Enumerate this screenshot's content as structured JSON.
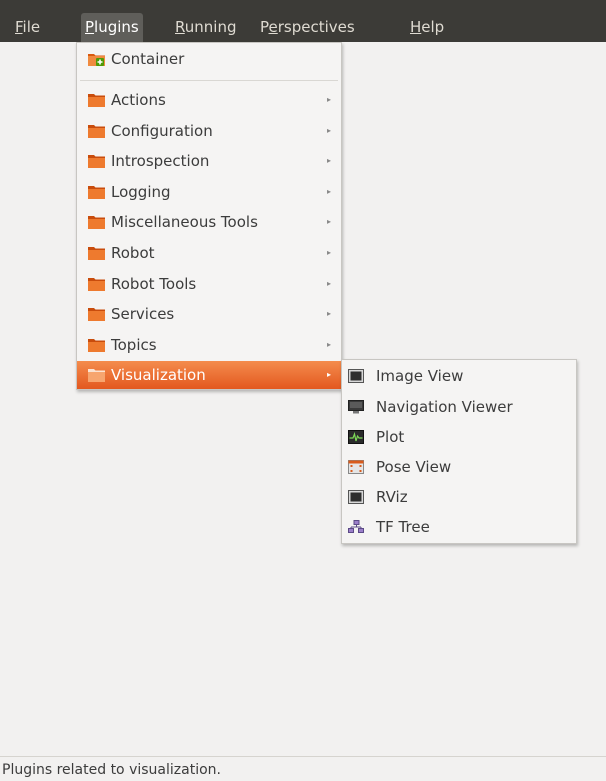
{
  "menubar": {
    "items": [
      {
        "mnemonic": "F",
        "rest": "ile"
      },
      {
        "mnemonic": "P",
        "rest": "lugins"
      },
      {
        "mnemonic": "R",
        "rest": "unning"
      },
      {
        "pre": "P",
        "mnemonic": "e",
        "rest": "rspectives"
      },
      {
        "mnemonic": "H",
        "rest": "elp"
      }
    ]
  },
  "plugins_menu": {
    "container": "Container",
    "items": [
      "Actions",
      "Configuration",
      "Introspection",
      "Logging",
      "Miscellaneous Tools",
      "Robot",
      "Robot Tools",
      "Services",
      "Topics",
      "Visualization"
    ],
    "arrow": "▸"
  },
  "visualization_submenu": {
    "items": [
      "Image View",
      "Navigation Viewer",
      "Plot",
      "Pose View",
      "RViz",
      "TF Tree"
    ]
  },
  "status": "Plugins related to visualization.",
  "colors": {
    "highlight": "#e8632a",
    "menubar": "#3c3b37",
    "folder": "#e85f1c"
  }
}
